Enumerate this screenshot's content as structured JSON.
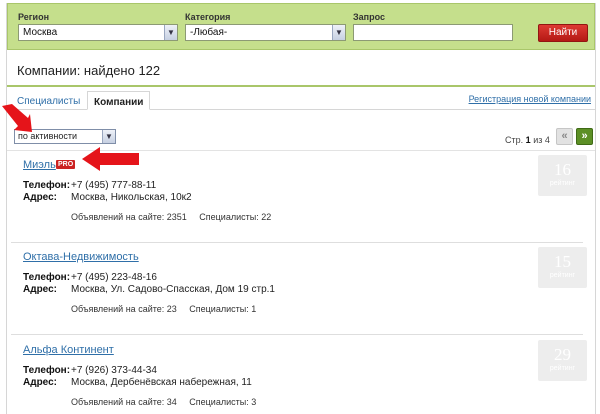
{
  "search": {
    "region_label": "Регион",
    "region_value": "Москва",
    "category_label": "Категория",
    "category_value": "-Любая-",
    "query_label": "Запрос",
    "query_value": "",
    "find_button": "Найти"
  },
  "results": {
    "title": "Компании: найдено 122"
  },
  "tabs": [
    {
      "label": "Специалисты",
      "active": false
    },
    {
      "label": "Компании",
      "active": true
    }
  ],
  "register_link": "Регистрация новой компании",
  "sort": {
    "value": "по активности"
  },
  "pager": {
    "prefix": "Стр.",
    "current": "1",
    "middle": "из",
    "total": "4",
    "prev": "«",
    "next": "»"
  },
  "labels": {
    "phone": "Телефон:",
    "address": "Адрес:",
    "rating_word": "рейтинг"
  },
  "companies": [
    {
      "name": "Миэль",
      "pro": "PRO",
      "phone": "+7 (495) 777-88-11",
      "address": "Москва, Никольская, 10к2",
      "stats": "Объявлений на сайте: 2351     Специалисты: 22",
      "rating": "16"
    },
    {
      "name": "Октава-Недвижимость",
      "pro": "",
      "phone": "+7 (495) 223-48-16",
      "address": "Москва, Ул. Садово-Спасская, Дом 19 стр.1",
      "stats": "Объявлений на сайте: 23     Специалисты: 1",
      "rating": "15"
    },
    {
      "name": "Альфа Континент",
      "pro": "",
      "phone": "+7 (926) 373-44-34",
      "address": "Москва, Дербенёвская набережная, 11",
      "stats": "Объявлений на сайте: 34     Специалисты: 3",
      "rating": "29"
    }
  ],
  "colors": {
    "header_bg": "#c5df8c",
    "accent_red": "#cc2222",
    "link": "#2f6fa8",
    "pager_green": "#5c8f25"
  }
}
